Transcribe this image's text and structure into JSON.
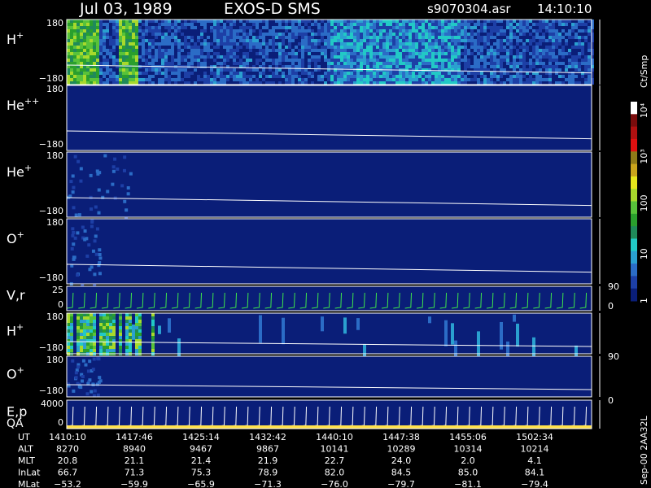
{
  "header": {
    "date": "Jul 03, 1989",
    "instrument": "EXOS-D SMS",
    "file": "s9070304.asr",
    "time": "14:10:10"
  },
  "colorbar": {
    "label": "Ct/Smp",
    "ticks": [
      "1",
      "10",
      "100",
      "10³",
      "10⁴"
    ],
    "colors": [
      "#0a1e78",
      "#1d3fa6",
      "#2b6cc6",
      "#2aa0d0",
      "#22c9c6",
      "#1f8a5a",
      "#2a9f2d",
      "#58c23a",
      "#a7d92c",
      "#e6e61c",
      "#c9a41c",
      "#8f7a18",
      "#e01010",
      "#b01010",
      "#7a0c0c",
      "#ffffff"
    ]
  },
  "panels": [
    {
      "id": "h-plus",
      "label": "H",
      "sup": "+",
      "ytop": "180",
      "ybot": "−180"
    },
    {
      "id": "he-plus-plus",
      "label": "He",
      "sup": "++",
      "ytop": "180",
      "ybot": "−180"
    },
    {
      "id": "he-plus",
      "label": "He",
      "sup": "+",
      "ytop": "180",
      "ybot": "−180"
    },
    {
      "id": "o-plus",
      "label": "O",
      "sup": "+",
      "ytop": "180",
      "ybot": "−180"
    },
    {
      "id": "v-r",
      "label": "V,r",
      "sup": "",
      "ytop": "25",
      "ybot": "0",
      "right": [
        "90",
        "0"
      ]
    },
    {
      "id": "h-plus-2",
      "label": "H",
      "sup": "+",
      "ytop": "180",
      "ybot": "−180"
    },
    {
      "id": "o-plus-2",
      "label": "O",
      "sup": "+",
      "ytop": "180",
      "ybot": "−180",
      "right": [
        "90"
      ]
    },
    {
      "id": "ep-qa",
      "label": "E,p",
      "label2": "QA",
      "sup": "",
      "ytop": "4000",
      "ybot": "0",
      "right": [
        "0"
      ]
    }
  ],
  "orbit_table": {
    "rows": [
      {
        "name": "UT",
        "values": [
          "1410:10",
          "1417:46",
          "1425:14",
          "1432:42",
          "1440:10",
          "1447:38",
          "1455:06",
          "1502:34"
        ]
      },
      {
        "name": "ALT",
        "values": [
          "8270",
          "8940",
          "9467",
          "9867",
          "10141",
          "10289",
          "10314",
          "10214"
        ]
      },
      {
        "name": "MLT",
        "values": [
          "20.8",
          "21.1",
          "21.4",
          "21.9",
          "22.7",
          "24.0",
          "2.0",
          "4.1"
        ]
      },
      {
        "name": "InLat",
        "values": [
          "66.7",
          "71.3",
          "75.3",
          "78.9",
          "82.0",
          "84.5",
          "85.0",
          "84.1"
        ]
      },
      {
        "name": "MLat",
        "values": [
          "−53.2",
          "−59.9",
          "−65.9",
          "−71.3",
          "−76.0",
          "−79.7",
          "−81.1",
          "−79.4"
        ]
      }
    ]
  },
  "side_label": "Sep-00 2AA32L",
  "chart_data": {
    "type": "heatmap",
    "title": "Jul 03, 1989 EXOS-D SMS",
    "xlabel": "UT",
    "x_ticks": [
      "1410:10",
      "1417:46",
      "1425:14",
      "1432:42",
      "1440:10",
      "1447:38",
      "1455:06",
      "1502:34"
    ],
    "color_scale": {
      "label": "Ct/Smp",
      "log": true,
      "range": [
        1,
        10000
      ]
    },
    "panels": [
      {
        "species": "H+",
        "ylim": [
          -180,
          180
        ]
      },
      {
        "species": "He++",
        "ylim": [
          -180,
          180
        ]
      },
      {
        "species": "He+",
        "ylim": [
          -180,
          180
        ]
      },
      {
        "species": "O+",
        "ylim": [
          -180,
          180
        ]
      },
      {
        "species": "V,r",
        "ylim": [
          0,
          25
        ],
        "right_ticks": [
          "0",
          "90"
        ]
      },
      {
        "species": "H+",
        "ylim": [
          -180,
          180
        ]
      },
      {
        "species": "O+",
        "ylim": [
          -180,
          180
        ],
        "right_ticks": [
          "90"
        ]
      },
      {
        "species": "E,p / QA",
        "ylim": [
          0,
          4000
        ],
        "right_ticks": [
          "0"
        ]
      }
    ]
  }
}
